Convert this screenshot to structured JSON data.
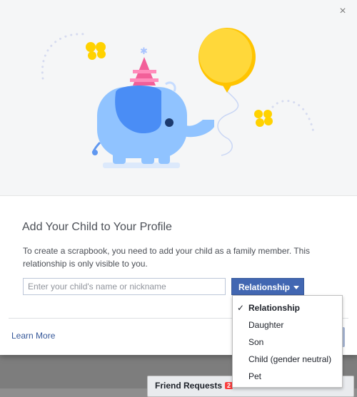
{
  "dialog": {
    "close_icon": "×",
    "title": "Add Your Child to Your Profile",
    "description": "To create a scrapbook, you need to add your child as a family member. This relationship is only visible to you.",
    "name_input": {
      "placeholder": "Enter your child's name or nickname",
      "value": ""
    },
    "relationship_button": {
      "label": "Relationship"
    },
    "learn_more": "Learn More",
    "illustration": "elephant-with-party-hat-and-balloon"
  },
  "dropdown": {
    "selected": "Relationship",
    "check_icon": "✓",
    "options": [
      "Relationship",
      "Daughter",
      "Son",
      "Child (gender neutral)",
      "Pet"
    ]
  },
  "background": {
    "friend_requests_label": "Friend Requests",
    "friend_requests_count": "2"
  },
  "colors": {
    "accent": "#4267b2",
    "link": "#365899",
    "elephant": "#90c3ff",
    "balloon": "#ffd200",
    "party_hat": "#f25f99"
  }
}
